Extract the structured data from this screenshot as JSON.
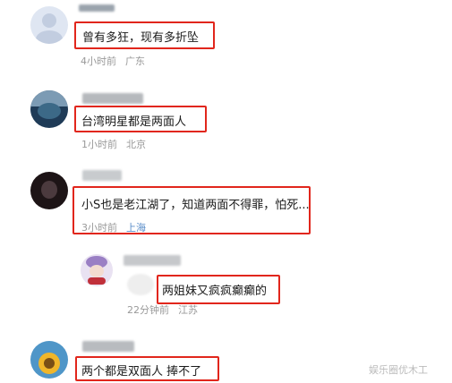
{
  "comments": [
    {
      "text": "曾有多狂，现有多折坠",
      "time": "4小时前",
      "location": "广东"
    },
    {
      "text": "台湾明星都是两面人",
      "time": "1小时前",
      "location": "北京"
    },
    {
      "text": "小S也是老江湖了，知道两面不得罪，怕死...",
      "time": "3小时前",
      "location": "上海"
    },
    {
      "text": "两姐妹又疯疯癫癫的",
      "time": "22分钟前",
      "location": "江苏"
    },
    {
      "text": "两个都是双面人 捧不了",
      "time": "",
      "location": ""
    }
  ],
  "watermark": "娱乐圈优木工",
  "colors": {
    "highlight": "#e1261c",
    "meta": "#999999",
    "location_blue": "#5b8ec9"
  }
}
